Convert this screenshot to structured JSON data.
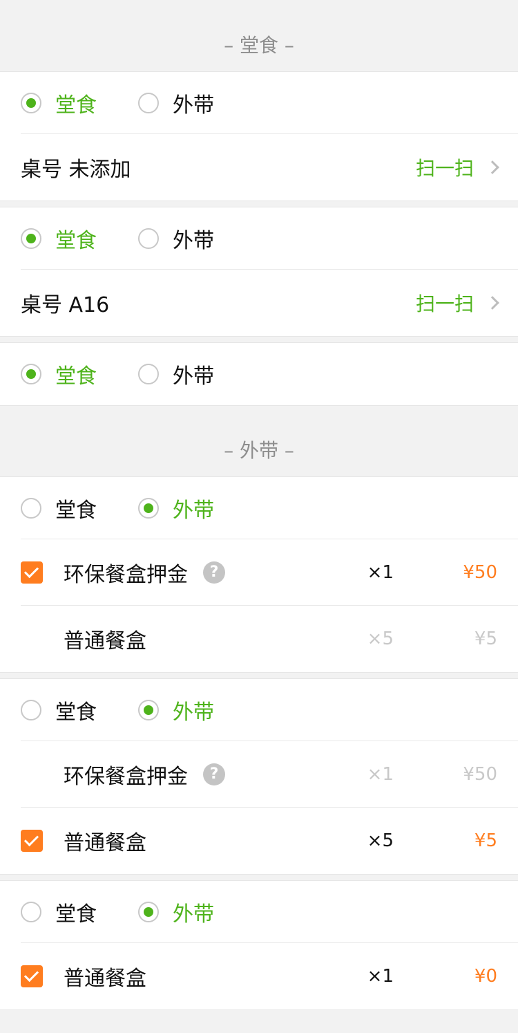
{
  "colors": {
    "accent_green": "#4eb31b",
    "accent_orange": "#ff7d1f",
    "muted": "#c8c8c8"
  },
  "section_dinein": {
    "title": "– 堂食 –"
  },
  "section_takeout": {
    "title": "– 外带 –"
  },
  "dine_label": "堂食",
  "take_label": "外带",
  "scan_label": "扫一扫",
  "help_glyph": "?",
  "table1": {
    "label": "桌号 未添加"
  },
  "table2": {
    "label": "桌号 A16"
  },
  "card4": {
    "items": [
      {
        "name": "环保餐盒押金",
        "qty": "×1",
        "price": "¥50",
        "checked": true,
        "has_help": true
      },
      {
        "name": "普通餐盒",
        "qty": "×5",
        "price": "¥5",
        "checked": false
      }
    ]
  },
  "card5": {
    "items": [
      {
        "name": "环保餐盒押金",
        "qty": "×1",
        "price": "¥50",
        "checked": false,
        "has_help": true
      },
      {
        "name": "普通餐盒",
        "qty": "×5",
        "price": "¥5",
        "checked": true
      }
    ]
  },
  "card6": {
    "items": [
      {
        "name": "普通餐盒",
        "qty": "×1",
        "price": "¥0",
        "checked": true
      }
    ]
  }
}
